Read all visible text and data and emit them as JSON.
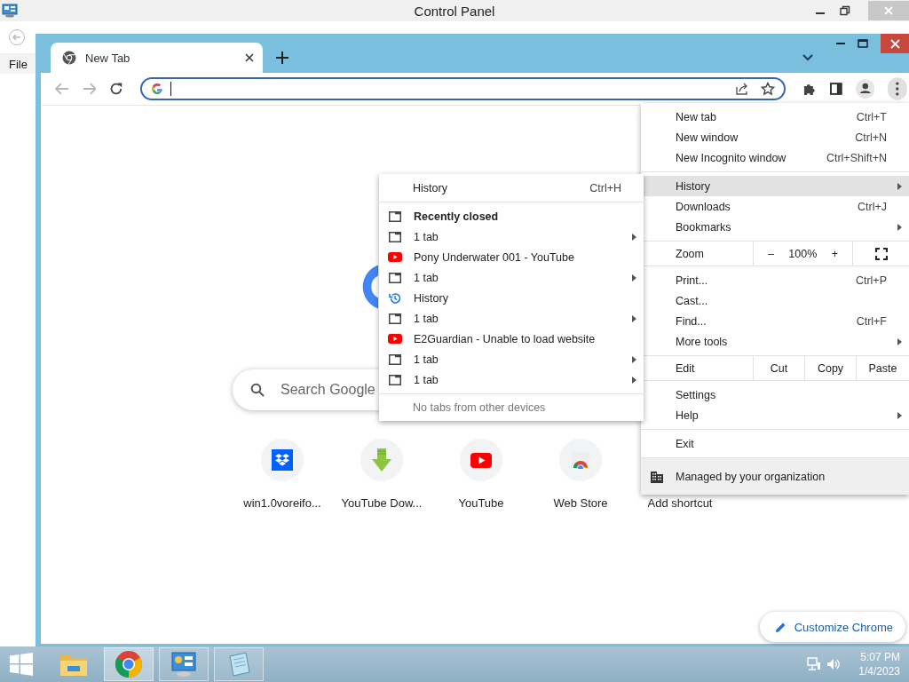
{
  "background_window": {
    "title": "Control Panel",
    "menu": [
      "File"
    ]
  },
  "browser": {
    "tabs": [
      {
        "label": "New Tab",
        "selected": true
      }
    ],
    "new_tab_page": {
      "search": {
        "placeholder": "Search Google"
      },
      "shortcuts": [
        {
          "kind": "dropbox",
          "label": "win1.0voreifo..."
        },
        {
          "kind": "download",
          "label": "YouTube Dow..."
        },
        {
          "kind": "youtube",
          "label": "YouTube"
        },
        {
          "kind": "webstore",
          "label": "Web Store"
        },
        {
          "kind": "add",
          "label": "Add shortcut"
        }
      ],
      "customize_button": "Customize Chrome"
    },
    "menu": {
      "sections": [
        [
          {
            "kind": "item",
            "label": "New tab",
            "shortcut": "Ctrl+T",
            "submenu": false,
            "selected": false
          },
          {
            "kind": "item",
            "label": "New window",
            "shortcut": "Ctrl+N",
            "submenu": false,
            "selected": false
          },
          {
            "kind": "item",
            "label": "New Incognito window",
            "shortcut": "Ctrl+Shift+N",
            "submenu": false,
            "selected": false
          }
        ],
        [
          {
            "kind": "item",
            "label": "History",
            "submenu": true,
            "selected": true
          },
          {
            "kind": "item",
            "label": "Downloads",
            "shortcut": "Ctrl+J",
            "submenu": false,
            "selected": false
          },
          {
            "kind": "item",
            "label": "Bookmarks",
            "submenu": true,
            "selected": false
          }
        ],
        [
          {
            "kind": "zoom",
            "label": "Zoom",
            "minus": "–",
            "value": "100%",
            "plus": "+"
          }
        ],
        [
          {
            "kind": "item",
            "label": "Print...",
            "shortcut": "Ctrl+P",
            "submenu": false,
            "selected": false
          },
          {
            "kind": "item",
            "label": "Cast...",
            "submenu": false,
            "selected": false
          },
          {
            "kind": "item",
            "label": "Find...",
            "shortcut": "Ctrl+F",
            "submenu": false,
            "selected": false
          },
          {
            "kind": "item",
            "label": "More tools",
            "submenu": true,
            "selected": false
          }
        ],
        [
          {
            "kind": "edit",
            "label": "Edit",
            "buttons": [
              "Cut",
              "Copy",
              "Paste"
            ]
          }
        ],
        [
          {
            "kind": "item",
            "label": "Settings",
            "submenu": false,
            "selected": false
          },
          {
            "kind": "item",
            "label": "Help",
            "submenu": true,
            "selected": false
          }
        ],
        [
          {
            "kind": "item",
            "label": "Exit",
            "submenu": false,
            "selected": false
          }
        ],
        [
          {
            "kind": "managed",
            "label": "Managed by your organization"
          }
        ]
      ]
    },
    "history_submenu": {
      "header": {
        "label": "History",
        "shortcut": "Ctrl+H"
      },
      "items": [
        {
          "kind": "heading",
          "label": "Recently closed",
          "submenu": false
        },
        {
          "kind": "tab",
          "label": "1 tab",
          "submenu": true
        },
        {
          "kind": "youtube",
          "label": "Pony Underwater 001 - YouTube",
          "submenu": false
        },
        {
          "kind": "tab",
          "label": "1 tab",
          "submenu": true
        },
        {
          "kind": "history",
          "label": "History",
          "submenu": false
        },
        {
          "kind": "tab",
          "label": "1 tab",
          "submenu": true
        },
        {
          "kind": "youtube",
          "label": "E2Guardian - Unable to load website",
          "submenu": false
        },
        {
          "kind": "tab",
          "label": "1 tab",
          "submenu": true
        },
        {
          "kind": "tab",
          "label": "1 tab",
          "submenu": true
        }
      ],
      "footer": "No tabs from other devices"
    }
  },
  "taskbar": {
    "apps": [
      {
        "kind": "explorer",
        "open": false,
        "selected": false
      },
      {
        "kind": "chrome",
        "open": true,
        "selected": true
      },
      {
        "kind": "control-panel",
        "open": true,
        "selected": false
      },
      {
        "kind": "notepad",
        "open": true,
        "selected": false
      }
    ],
    "clock": {
      "time": "5:07 PM",
      "date": "1/4/2023"
    }
  }
}
